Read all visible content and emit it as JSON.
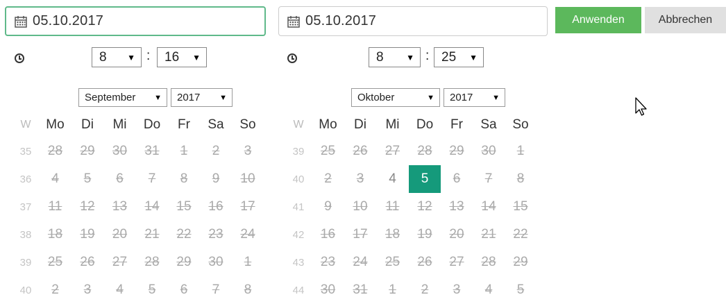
{
  "start": {
    "date_value": "05.10.2017",
    "hour": "8",
    "minute": "16",
    "month_select": "September",
    "year_select": "2017"
  },
  "end": {
    "date_value": "05.10.2017",
    "hour": "8",
    "minute": "25",
    "month_select": "Oktober",
    "year_select": "2017"
  },
  "buttons": {
    "apply": "Anwenden",
    "cancel": "Abbrechen"
  },
  "time_separator": ":",
  "weekday_headers": [
    "W",
    "Mo",
    "Di",
    "Mi",
    "Do",
    "Fr",
    "Sa",
    "So"
  ],
  "calendar_left": {
    "weeks": [
      {
        "wk": "35",
        "days": [
          "28",
          "29",
          "30",
          "31",
          "1",
          "2",
          "3"
        ]
      },
      {
        "wk": "36",
        "days": [
          "4",
          "5",
          "6",
          "7",
          "8",
          "9",
          "10"
        ]
      },
      {
        "wk": "37",
        "days": [
          "11",
          "12",
          "13",
          "14",
          "15",
          "16",
          "17"
        ]
      },
      {
        "wk": "38",
        "days": [
          "18",
          "19",
          "20",
          "21",
          "22",
          "23",
          "24"
        ]
      },
      {
        "wk": "39",
        "days": [
          "25",
          "26",
          "27",
          "28",
          "29",
          "30",
          "1"
        ]
      },
      {
        "wk": "40",
        "days": [
          "2",
          "3",
          "4",
          "5",
          "6",
          "7",
          "8"
        ]
      }
    ]
  },
  "calendar_right": {
    "weeks": [
      {
        "wk": "39",
        "days": [
          "25",
          "26",
          "27",
          "28",
          "29",
          "30",
          "1"
        ]
      },
      {
        "wk": "40",
        "days": [
          "2",
          "3",
          "4",
          "5",
          "6",
          "7",
          "8"
        ]
      },
      {
        "wk": "41",
        "days": [
          "9",
          "10",
          "11",
          "12",
          "13",
          "14",
          "15"
        ]
      },
      {
        "wk": "42",
        "days": [
          "16",
          "17",
          "18",
          "19",
          "20",
          "21",
          "22"
        ]
      },
      {
        "wk": "43",
        "days": [
          "23",
          "24",
          "25",
          "26",
          "27",
          "28",
          "29"
        ]
      },
      {
        "wk": "44",
        "days": [
          "30",
          "31",
          "1",
          "2",
          "3",
          "4",
          "5"
        ]
      }
    ],
    "selected_day": "5"
  },
  "colors": {
    "accent_selected": "#159a7b",
    "apply_button": "#5cb85c",
    "focus_border": "#5fb98a"
  },
  "icons": {
    "calendar": "calendar-icon",
    "clock": "clock-icon",
    "dropdown": "triangle-down",
    "cursor": "mouse-pointer"
  }
}
